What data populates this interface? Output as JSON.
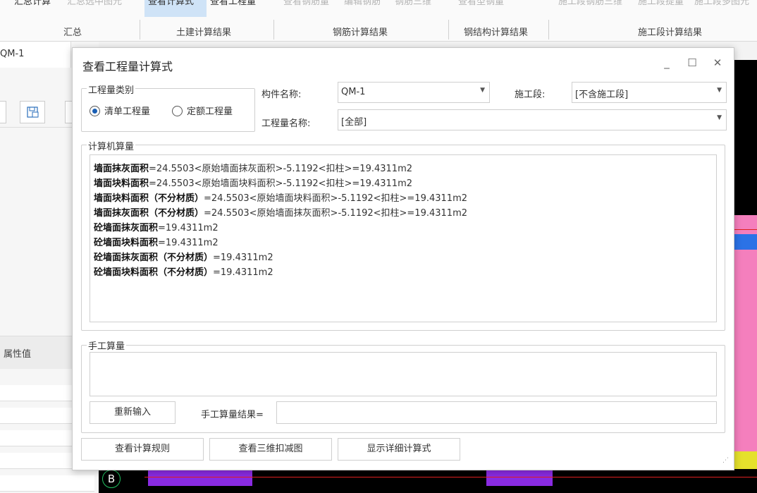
{
  "ribbon": {
    "top_items": [
      "汇总计算",
      "汇总选中图元",
      "查看计算式",
      "查看工程量",
      "查看钢筋量",
      "编辑钢筋",
      "钢筋三维",
      "查看型钢量",
      "施工段钢筋三维",
      "施工段提量",
      "施工段多图元"
    ],
    "groups": [
      "汇总",
      "土建计算结果",
      "钢筋计算结果",
      "钢结构计算结果",
      "施工段计算结果"
    ]
  },
  "left_panel": {
    "tab_label": "QM-1",
    "prop_header": "属性值"
  },
  "cad": {
    "axis_label": "B"
  },
  "dialog": {
    "title": "查看工程量计算式",
    "category_group": {
      "legend": "工程量类别",
      "options": [
        "清单工程量",
        "定额工程量"
      ],
      "selected": "清单工程量"
    },
    "component_name_label": "构件名称:",
    "component_name_value": "QM-1",
    "stage_label": "施工段:",
    "stage_value": "[不含施工段]",
    "quantity_name_label": "工程量名称:",
    "quantity_name_value": "[全部]",
    "computer_group": {
      "legend": "计算机算量",
      "lines": [
        {
          "name": "墙面抹灰面积",
          "expr": "=24.5503<原始墙面抹灰面积>-5.1192<扣柱>=19.4311m2"
        },
        {
          "name": "墙面块料面积",
          "expr": "=24.5503<原始墙面块料面积>-5.1192<扣柱>=19.4311m2"
        },
        {
          "name": "墙面块料面积（不分材质）",
          "expr": "=24.5503<原始墙面块料面积>-5.1192<扣柱>=19.4311m2"
        },
        {
          "name": "墙面抹灰面积（不分材质）",
          "expr": "=24.5503<原始墙面抹灰面积>-5.1192<扣柱>=19.4311m2"
        },
        {
          "name": "砼墙面抹灰面积",
          "expr": "=19.4311m2"
        },
        {
          "name": "砼墙面块料面积",
          "expr": "=19.4311m2"
        },
        {
          "name": "砼墙面抹灰面积（不分材质）",
          "expr": "=19.4311m2"
        },
        {
          "name": "砼墙面块料面积（不分材质）",
          "expr": "=19.4311m2"
        }
      ]
    },
    "manual_group": {
      "legend": "手工算量",
      "reinput_button": "重新输入",
      "result_label": "手工算量结果=",
      "result_value": ""
    },
    "buttons": {
      "view_rules": "查看计算规则",
      "view_3d": "查看三维扣减图",
      "show_detail": "显示详细计算式"
    },
    "window_controls": {
      "minimize": "_",
      "maximize": "☐",
      "close": "✕"
    }
  }
}
